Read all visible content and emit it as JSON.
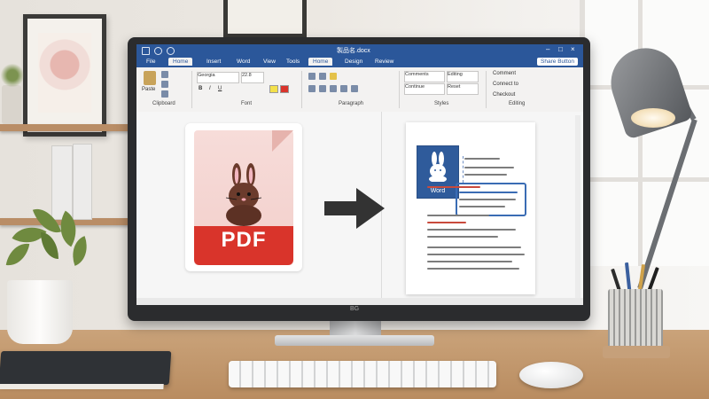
{
  "word": {
    "title": "製品名.docx",
    "tabs": [
      "File",
      "Home",
      "Insert",
      "Word",
      "View",
      "Tools",
      "Home",
      "Design",
      "Review"
    ],
    "active_tab": "Home",
    "share_label": "Share Button",
    "ribbon": {
      "clipboard_label": "Clipboard",
      "font_label": "Font",
      "paragraph_label": "Paragraph",
      "styles_label": "Styles",
      "editing_label": "Editing",
      "paste_label": "Paste",
      "font_name": "Georgia",
      "font_size": "22.8",
      "style_items": [
        "Comments",
        "Editing",
        "Continue",
        "Reset"
      ],
      "editing_items": [
        "Comment",
        "Connect to",
        "Checkout"
      ]
    },
    "tile_label": "Word"
  },
  "pdf": {
    "label": "PDF"
  },
  "monitor_logo": "BG",
  "colors": {
    "word_blue": "#2b579a",
    "pdf_red": "#d9342b",
    "arrow": "#333333"
  }
}
